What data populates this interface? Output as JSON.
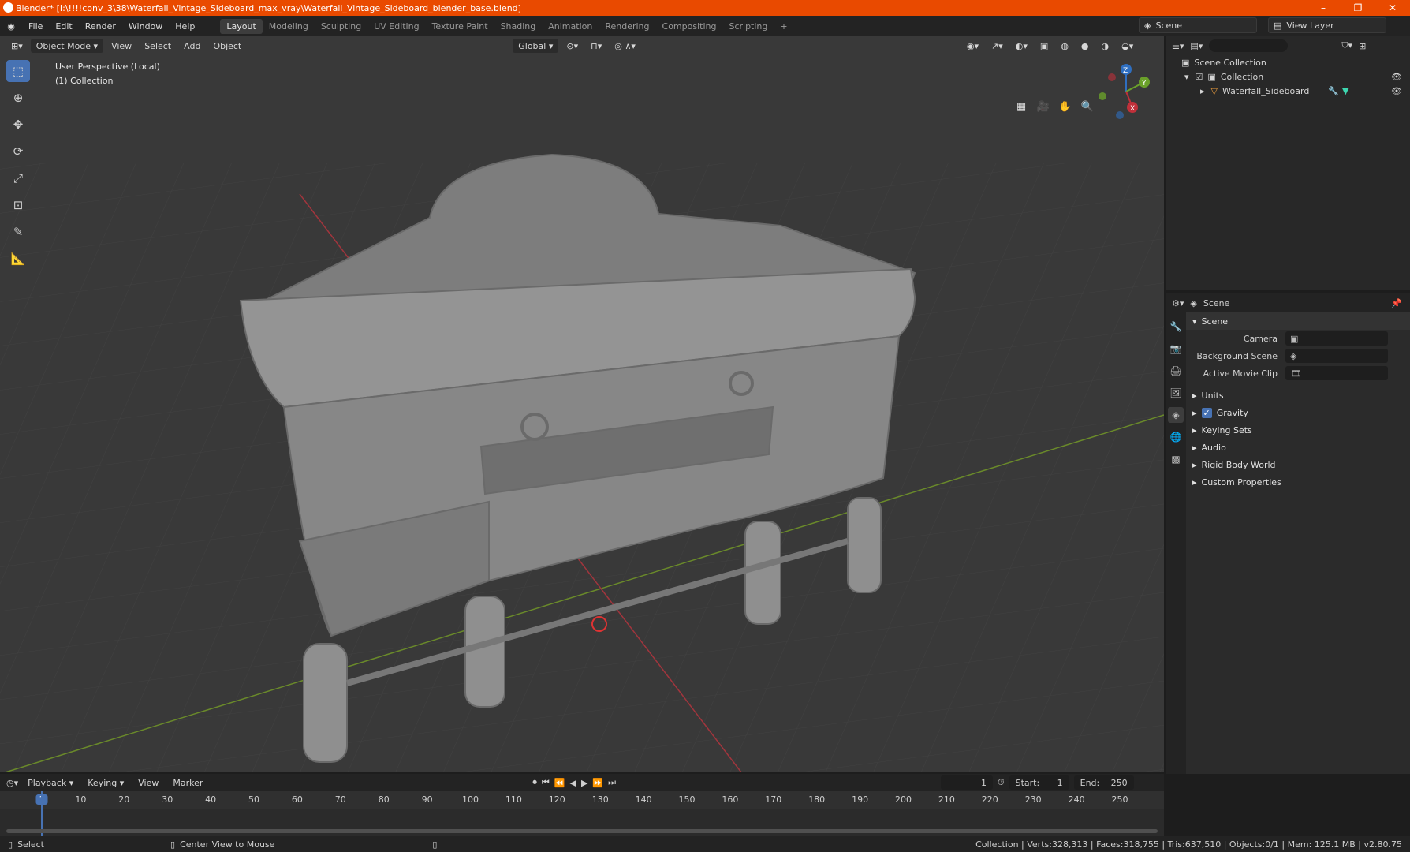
{
  "window": {
    "title": "Blender* [I:\\!!!!conv_3\\38\\Waterfall_Vintage_Sideboard_max_vray\\Waterfall_Vintage_Sideboard_blender_base.blend]",
    "min": "–",
    "max": "❐",
    "close": "✕"
  },
  "menu": [
    "File",
    "Edit",
    "Render",
    "Window",
    "Help"
  ],
  "workspaces": [
    "Layout",
    "Modeling",
    "Sculpting",
    "UV Editing",
    "Texture Paint",
    "Shading",
    "Animation",
    "Rendering",
    "Compositing",
    "Scripting",
    "+"
  ],
  "scene_field": "Scene",
  "view_layer_field": "View Layer",
  "viewport": {
    "mode": "Object Mode",
    "menus": [
      "View",
      "Select",
      "Add",
      "Object"
    ],
    "orientation": "Global",
    "perspective": "User Perspective (Local)",
    "collection": "(1) Collection",
    "gizmo": {
      "x": "X",
      "y": "Y",
      "z": "Z"
    }
  },
  "outliner": {
    "root": "Scene Collection",
    "collection": "Collection",
    "object": "Waterfall_Sideboard"
  },
  "properties": {
    "context": "Scene",
    "section": "Scene",
    "fields": [
      {
        "label": "Camera",
        "value": ""
      },
      {
        "label": "Background Scene",
        "value": ""
      },
      {
        "label": "Active Movie Clip",
        "value": ""
      }
    ],
    "subpanels": [
      "Units",
      "Gravity",
      "Keying Sets",
      "Audio",
      "Rigid Body World",
      "Custom Properties"
    ]
  },
  "timeline": {
    "menus": [
      "Playback",
      "Keying",
      "View",
      "Marker"
    ],
    "current_frame": "1",
    "start_label": "Start:",
    "start": "1",
    "end_label": "End:",
    "end": "250",
    "ticks": [
      "1",
      "10",
      "20",
      "30",
      "40",
      "50",
      "60",
      "70",
      "80",
      "90",
      "100",
      "110",
      "120",
      "130",
      "140",
      "150",
      "160",
      "170",
      "180",
      "190",
      "200",
      "210",
      "220",
      "230",
      "240",
      "250"
    ]
  },
  "status": {
    "select": "Select",
    "center": "Center View to Mouse",
    "stats": "Collection | Verts:328,313 | Faces:318,755 | Tris:637,510 | Objects:0/1 | Mem: 125.1 MB | v2.80.75"
  },
  "colors": {
    "accent": "#4772b3",
    "titlebar": "#e94a00",
    "viewport": "#393939"
  }
}
